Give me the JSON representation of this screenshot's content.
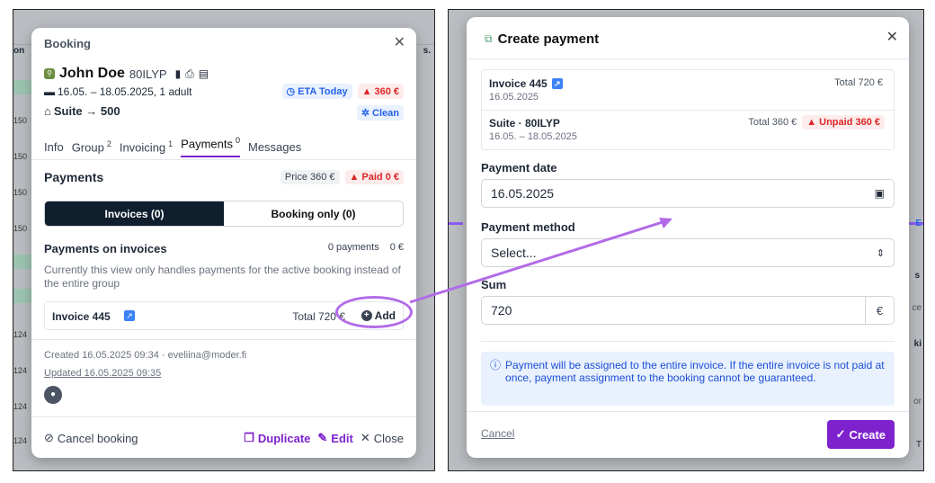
{
  "booking": {
    "title": "Booking",
    "guest_name": "John Doe",
    "booking_code": "80ILYP",
    "dates": "16.05. – 18.05.2025, 1 adult",
    "eta": "ETA Today",
    "balance_badge": "360 €",
    "room": "Suite → 500",
    "clean": "Clean",
    "tabs": [
      {
        "label": "Info",
        "count": ""
      },
      {
        "label": "Group",
        "count": "2"
      },
      {
        "label": "Invoicing",
        "count": "1"
      },
      {
        "label": "Payments",
        "count": "0"
      },
      {
        "label": "Messages",
        "count": ""
      }
    ],
    "payments_heading": "Payments",
    "price": "Price 360 €",
    "paid": "Paid 0 €",
    "seg_invoices": "Invoices (0)",
    "seg_booking": "Booking only (0)",
    "pay_on_invoices": "Payments on invoices",
    "pay_count": "0 payments",
    "pay_sum": "0 €",
    "note": "Currently this view only handles payments for the active booking instead of the entire group",
    "invoice_label": "Invoice 445",
    "invoice_total": "Total 720 €",
    "add": "Add",
    "created": "Created 16.05.2025 09:34 · eveliina@moder.fi",
    "updated": "Updated 16.05.2025 09:35",
    "cancel": "Cancel booking",
    "duplicate": "Duplicate",
    "edit": "Edit",
    "close": "Close",
    "bg_numbers": [
      "150",
      "150",
      "150",
      "150",
      "124",
      "124",
      "124",
      "124"
    ],
    "bg_header_left": "on",
    "bg_header_right": "s."
  },
  "payment": {
    "title": "Create payment",
    "invoice_label": "Invoice 445",
    "invoice_date": "16.05.2025",
    "invoice_total": "Total 720 €",
    "suite_label": "Suite · 80ILYP",
    "suite_dates": "16.05. – 18.05.2025",
    "suite_total": "Total 360 €",
    "suite_unpaid": "Unpaid 360 €",
    "date_label": "Payment date",
    "date_value": "16.05.2025",
    "method_label": "Payment method",
    "method_value": "Select...",
    "sum_label": "Sum",
    "sum_value": "720",
    "currency": "€",
    "info": "Payment will be assigned to the entire invoice. If the entire invoice is not paid at once, payment assignment to the booking cannot be guaranteed.",
    "cancel": "Cancel",
    "create": "Create",
    "bg_right": [
      "E",
      "s",
      "ce",
      "ki",
      "or",
      "T"
    ]
  },
  "colors": {
    "accent": "#7e22ce",
    "annotation": "#b26be8",
    "danger": "#dc2626",
    "info": "#2563eb",
    "segment_dark": "#0f1f2e"
  }
}
